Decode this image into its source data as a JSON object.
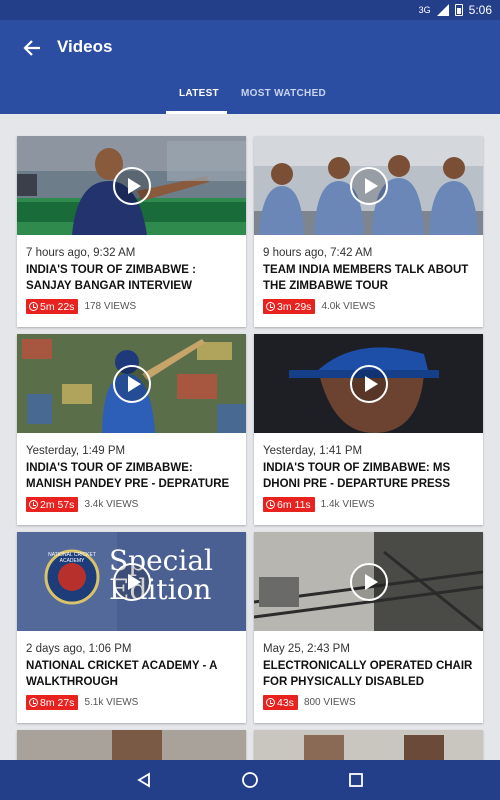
{
  "status_bar": {
    "network": "3G",
    "time": "5:06"
  },
  "app_bar": {
    "title": "Videos"
  },
  "tabs": [
    {
      "label": "LATEST"
    },
    {
      "label": "MOST WATCHED"
    }
  ],
  "videos": [
    {
      "time": "7 hours ago, 9:32 AM",
      "title": "INDIA'S TOUR OF ZIMBABWE : SANJAY BANGAR INTERVIEW",
      "duration": "5m 22s",
      "views": "178 VIEWS"
    },
    {
      "time": "9 hours ago, 7:42 AM",
      "title": "TEAM INDIA MEMBERS TALK ABOUT THE ZIMBABWE TOUR",
      "duration": "3m 29s",
      "views": "4.0k VIEWS"
    },
    {
      "time": "Yesterday, 1:49 PM",
      "title": "INDIA'S TOUR OF ZIMBABWE: MANISH PANDEY PRE - DEPRATURE ...",
      "duration": "2m 57s",
      "views": "3.4k VIEWS"
    },
    {
      "time": "Yesterday, 1:41 PM",
      "title": "INDIA'S TOUR OF ZIMBABWE: MS DHONI PRE - DEPARTURE PRESS CO...",
      "duration": "6m 11s",
      "views": "1.4k VIEWS"
    },
    {
      "time": "2 days ago, 1:06 PM",
      "title": "NATIONAL CRICKET ACADEMY - A WALKTHROUGH",
      "duration": "8m 27s",
      "views": "5.1k VIEWS"
    },
    {
      "time": "May 25, 2:43 PM",
      "title": "ELECTRONICALLY OPERATED CHAIR FOR PHYSICALLY DISABLED",
      "duration": "43s",
      "views": "800 VIEWS"
    }
  ],
  "thumb_text": {
    "special_line1": "Special",
    "special_line2": "Edition",
    "nca_badge": "NATIONAL CRICKET ACADEMY"
  }
}
